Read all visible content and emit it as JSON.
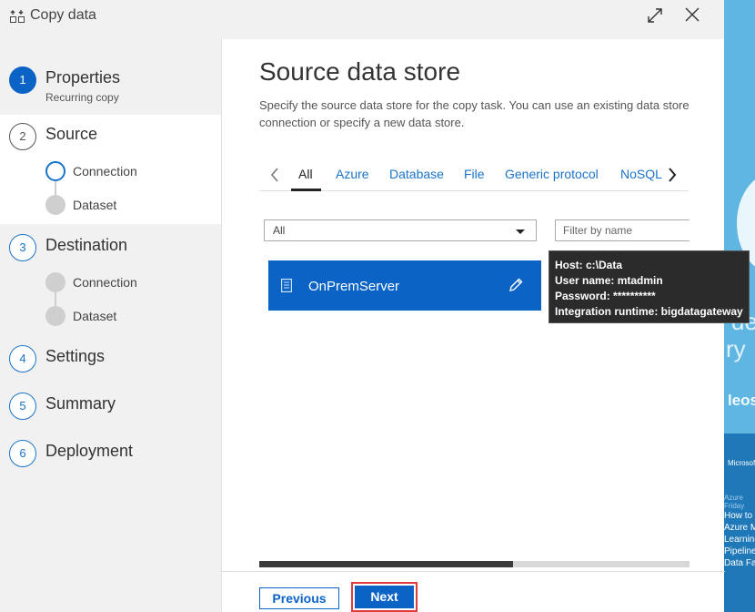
{
  "window": {
    "title": "Copy data"
  },
  "steps": [
    {
      "num": "1",
      "label": "Properties",
      "sub": "Recurring copy"
    },
    {
      "num": "2",
      "label": "Source",
      "substeps": [
        "Connection",
        "Dataset"
      ]
    },
    {
      "num": "3",
      "label": "Destination",
      "substeps": [
        "Connection",
        "Dataset"
      ]
    },
    {
      "num": "4",
      "label": "Settings"
    },
    {
      "num": "5",
      "label": "Summary"
    },
    {
      "num": "6",
      "label": "Deployment"
    }
  ],
  "main": {
    "title": "Source data store",
    "description": "Specify the source data store for the copy task. You can use an existing data store connection or specify a new data store.",
    "tabs": [
      "All",
      "Azure",
      "Database",
      "File",
      "Generic protocol",
      "NoSQL"
    ],
    "active_tab": "All",
    "filter_select": {
      "value": "All"
    },
    "filter_input": {
      "placeholder": "Filter by name"
    },
    "connections": [
      {
        "name": "OnPremServer"
      }
    ],
    "scroll_fraction": 0.59,
    "buttons": {
      "previous": "Previous",
      "next": "Next"
    }
  },
  "tooltip": {
    "lines": [
      "Host: c:\\Data",
      "User name: mtadmin",
      "Password: **********",
      "Integration runtime: bigdatagateway"
    ]
  },
  "background": {
    "fragments": [
      "de",
      "ry",
      "leos"
    ],
    "card": {
      "brand": "Microsoft",
      "series": "Azure Friday",
      "lines": [
        "How to",
        "Azure M",
        "Learning",
        "Pipeline",
        "Data Fac"
      ]
    }
  },
  "colors": {
    "accent": "#0b63c6",
    "highlight_border": "#e03c3c",
    "tooltip_bg": "#2b2b2b"
  }
}
